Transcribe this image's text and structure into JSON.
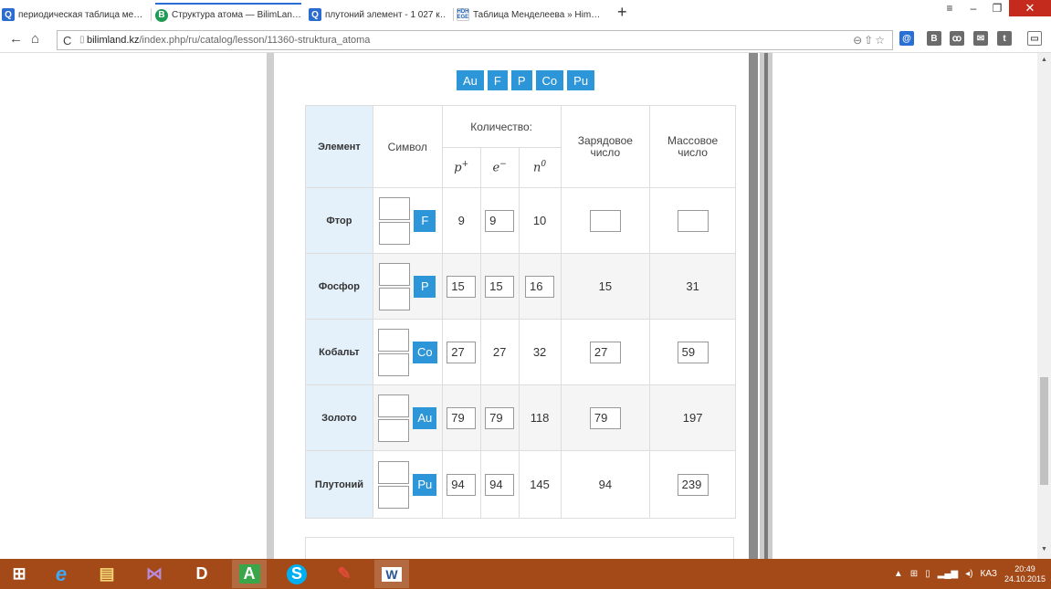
{
  "tabs": [
    {
      "title": "периодическая таблица ме…",
      "icon": "search-q-icon"
    },
    {
      "title": "Структура атома — BilimLan…",
      "icon": "bilimland-b-icon"
    },
    {
      "title": "плутоний элемент - 1 027 к…",
      "icon": "search-q-icon"
    },
    {
      "title": "Таблица Менделеева » Him…",
      "icon": "hdh-ege-icon"
    }
  ],
  "address": {
    "domain": "bilimland.kz",
    "path": "/index.php/ru/catalog/lesson/11360-struktura_atoma"
  },
  "element_buttons": [
    "Au",
    "F",
    "P",
    "Co",
    "Pu"
  ],
  "table": {
    "headers": {
      "element": "Элемент",
      "symbol": "Символ",
      "quantity": "Количество:",
      "p": "p",
      "p_sup": "+",
      "e": "e",
      "e_sup": "−",
      "n": "n",
      "n_sup": "0",
      "charge_line1": "Зарядовое",
      "charge_line2": "число",
      "mass_line1": "Массовое",
      "mass_line2": "число"
    },
    "rows": [
      {
        "name": "Фтор",
        "symbol": "F",
        "p": "9",
        "e": "9",
        "n": "10",
        "charge": "",
        "mass": ""
      },
      {
        "name": "Фосфор",
        "symbol": "P",
        "p": "15",
        "e": "15",
        "n": "16",
        "charge": "15",
        "mass": "31"
      },
      {
        "name": "Кобальт",
        "symbol": "Co",
        "p": "27",
        "e": "27",
        "n": "32",
        "charge": "27",
        "mass": "59"
      },
      {
        "name": "Золото",
        "symbol": "Au",
        "p": "79",
        "e": "79",
        "n": "118",
        "charge": "79",
        "mass": "197"
      },
      {
        "name": "Плутоний",
        "symbol": "Pu",
        "p": "94",
        "e": "94",
        "n": "145",
        "charge": "94",
        "mass": "239"
      }
    ]
  },
  "taskbar": {
    "lang": "КАЗ",
    "time": "20:49",
    "date": "24.10.2015"
  },
  "colors": {
    "accent": "#2d96d9",
    "header_bg": "#e4f1fb",
    "taskbar": "#a44a18"
  }
}
